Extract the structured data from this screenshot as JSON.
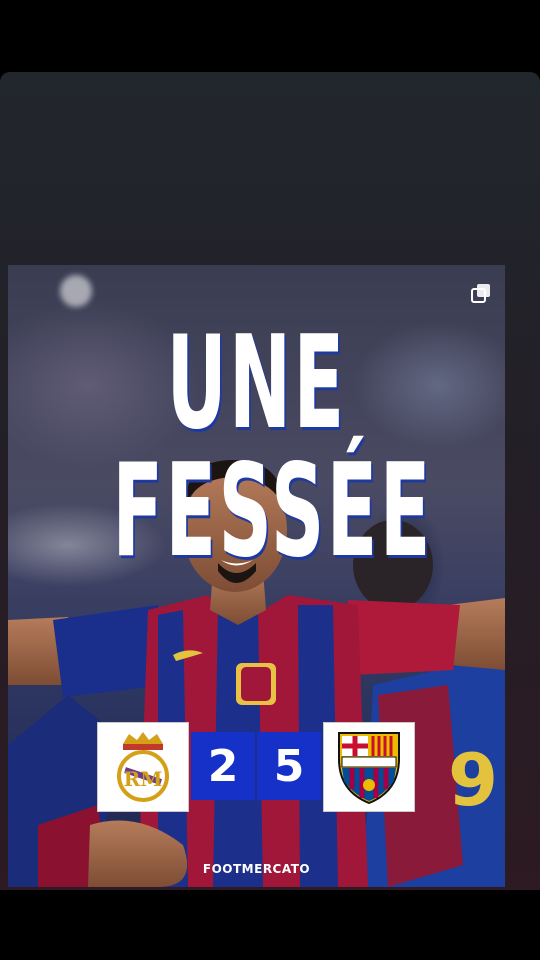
{
  "post": {
    "headline": "UNE FESSÉE",
    "score": {
      "home": "2",
      "away": "5"
    },
    "home_team": {
      "crest": "real-madrid-crest",
      "colors": [
        "#ffffff",
        "#d4a017",
        "#6a3b8f"
      ]
    },
    "away_team": {
      "crest": "fc-barcelona-crest",
      "colors": [
        "#a50044",
        "#004d98",
        "#edbb00"
      ]
    },
    "brand": "FOOTMERCATO",
    "multi_image_icon": "copy-icon"
  },
  "colors": {
    "score_bg": "#1531c8",
    "headline_shadow": "#1f3a9e"
  }
}
